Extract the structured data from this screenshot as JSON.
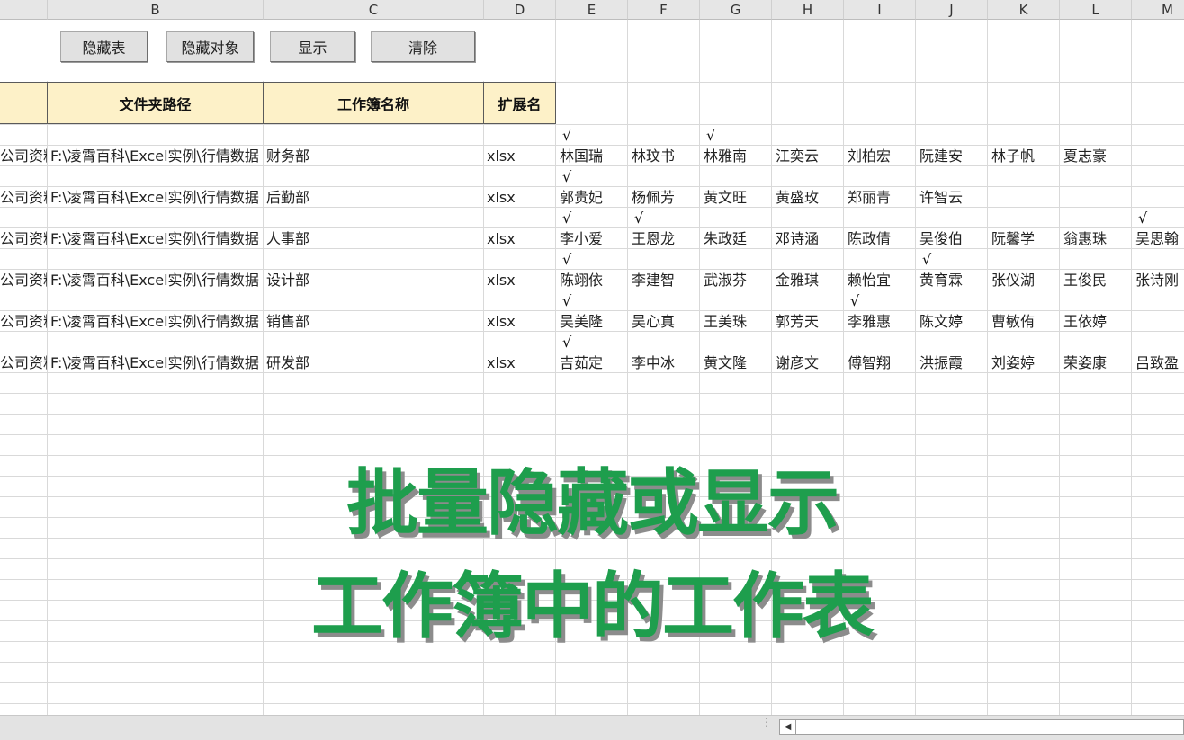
{
  "column_headers": [
    "B",
    "C",
    "D",
    "E",
    "F",
    "G",
    "H",
    "I",
    "J",
    "K",
    "L",
    "M"
  ],
  "buttons": {
    "hide_sheet": "隐藏表",
    "hide_object": "隐藏对象",
    "show": "显示",
    "clear": "清除"
  },
  "table_headers": {
    "folder_path": "文件夹路径",
    "workbook_name": "工作簿名称",
    "extension": "扩展名"
  },
  "rows": [
    {
      "a": "公司资料",
      "path": "F:\\凌霄百科\\Excel实例\\行情数据",
      "name": "财务部",
      "ext": "xlsx",
      "names": [
        "林国瑞",
        "林玟书",
        "林雅南",
        "江奕云",
        "刘柏宏",
        "阮建安",
        "林子帆",
        "夏志豪",
        ""
      ],
      "checks": [
        true,
        false,
        true,
        false,
        false,
        false,
        false,
        false,
        false
      ]
    },
    {
      "a": "公司资料",
      "path": "F:\\凌霄百科\\Excel实例\\行情数据",
      "name": "后勤部",
      "ext": "xlsx",
      "names": [
        "郭贵妃",
        "杨佩芳",
        "黄文旺",
        "黄盛玫",
        "郑丽青",
        "许智云",
        "",
        "",
        ""
      ],
      "checks": [
        true,
        false,
        false,
        false,
        false,
        false,
        false,
        false,
        false
      ]
    },
    {
      "a": "公司资料",
      "path": "F:\\凌霄百科\\Excel实例\\行情数据",
      "name": "人事部",
      "ext": "xlsx",
      "names": [
        "李小爱",
        "王恩龙",
        "朱政廷",
        "邓诗涵",
        "陈政倩",
        "吴俊伯",
        "阮馨学",
        "翁惠珠",
        "吴思翰"
      ],
      "checks": [
        true,
        true,
        false,
        false,
        false,
        false,
        false,
        false,
        true
      ]
    },
    {
      "a": "公司资料",
      "path": "F:\\凌霄百科\\Excel实例\\行情数据",
      "name": "设计部",
      "ext": "xlsx",
      "names": [
        "陈翊依",
        "李建智",
        "武淑芬",
        "金雅琪",
        "赖怡宜",
        "黄育霖",
        "张仪湖",
        "王俊民",
        "张诗刚"
      ],
      "checks": [
        true,
        false,
        false,
        false,
        false,
        true,
        false,
        false,
        false
      ]
    },
    {
      "a": "公司资料",
      "path": "F:\\凌霄百科\\Excel实例\\行情数据",
      "name": "销售部",
      "ext": "xlsx",
      "names": [
        "吴美隆",
        "吴心真",
        "王美珠",
        "郭芳天",
        "李雅惠",
        "陈文婷",
        "曹敏侑",
        "王依婷",
        ""
      ],
      "checks": [
        true,
        false,
        false,
        false,
        true,
        false,
        false,
        false,
        false
      ]
    },
    {
      "a": "公司资料",
      "path": "F:\\凌霄百科\\Excel实例\\行情数据",
      "name": "研发部",
      "ext": "xlsx",
      "names": [
        "吉茹定",
        "李中冰",
        "黄文隆",
        "谢彦文",
        "傅智翔",
        "洪振霞",
        "刘姿婷",
        "荣姿康",
        "吕致盈"
      ],
      "checks": [
        true,
        false,
        false,
        false,
        false,
        false,
        false,
        false,
        false
      ]
    }
  ],
  "check_mark": "√",
  "overlay_title": {
    "line1": "批量隐藏或显示",
    "line2": "工作簿中的工作表"
  },
  "colors": {
    "title_green": "#1e9e4d",
    "header_fill": "#fdf1c8"
  }
}
